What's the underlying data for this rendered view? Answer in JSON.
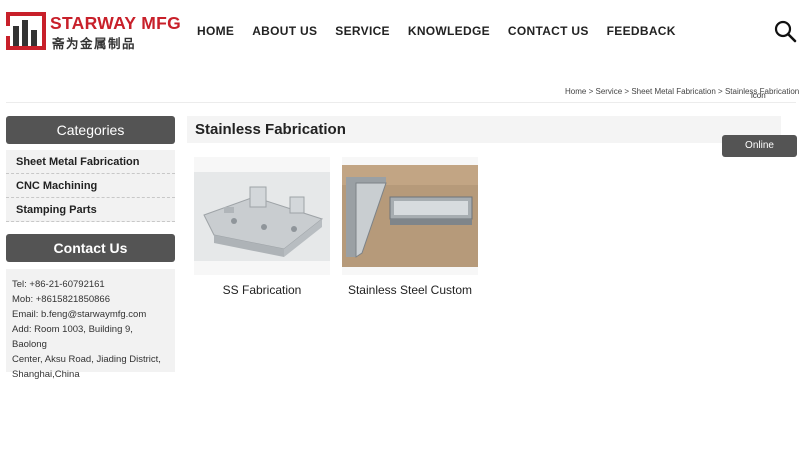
{
  "header": {
    "logo_text": "STARWAY MFG",
    "logo_subtext": "斋为金属制品",
    "nav": [
      "HOME",
      "ABOUT US",
      "SERVICE",
      "KNOWLEDGE",
      "CONTACT US",
      "FEEDBACK"
    ],
    "search_icon": "search-icon"
  },
  "breadcrumb": {
    "items": [
      "Home",
      "Service",
      "Sheet Metal Fabrication",
      "Stainless Fabrication"
    ],
    "separator": ">"
  },
  "icon_alt_text": "icon",
  "sidebar": {
    "categories_title": "Categories",
    "categories": [
      "Sheet Metal Fabrication",
      "CNC Machining",
      "Stamping Parts"
    ],
    "contact_title": "Contact Us",
    "contact_lines": [
      "Tel: +86-21-60792161",
      "Mob: +8615821850866",
      "Email: b.feng@starwaymfg.com",
      "Add: Room 1003, Building 9, Baolong",
      "Center, Aksu Road, Jiading District,",
      "Shanghai,China"
    ]
  },
  "main": {
    "title": "Stainless Fabrication",
    "products": [
      {
        "caption": "SS Fabrication"
      },
      {
        "caption": "Stainless Steel Custom"
      }
    ]
  },
  "online_button": "Online",
  "colors": {
    "brand_red": "#c8202a",
    "sidebar_header": "#545454",
    "panel_bg": "#f2f2f2"
  }
}
